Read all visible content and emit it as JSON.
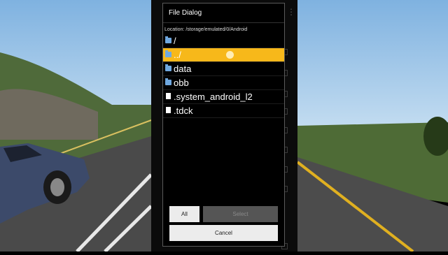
{
  "dialog": {
    "title": "File Dialog",
    "location": "Location: /storage/emulated/0/Android",
    "files": [
      {
        "name": "/",
        "icon": "folder-icon",
        "selected": false
      },
      {
        "name": "../",
        "icon": "folder-icon",
        "selected": true
      },
      {
        "name": "data",
        "icon": "folder-icon",
        "selected": false
      },
      {
        "name": "obb",
        "icon": "folder-icon",
        "selected": false
      },
      {
        "name": ".system_android_l2",
        "icon": "file-icon",
        "selected": false
      },
      {
        "name": ".tdck",
        "icon": "file-icon",
        "selected": false
      }
    ],
    "buttons": {
      "all": "All",
      "select": "Select",
      "cancel": "Cancel"
    }
  },
  "colors": {
    "selection": "#f7b81a",
    "folder": "#6fa8e0"
  }
}
